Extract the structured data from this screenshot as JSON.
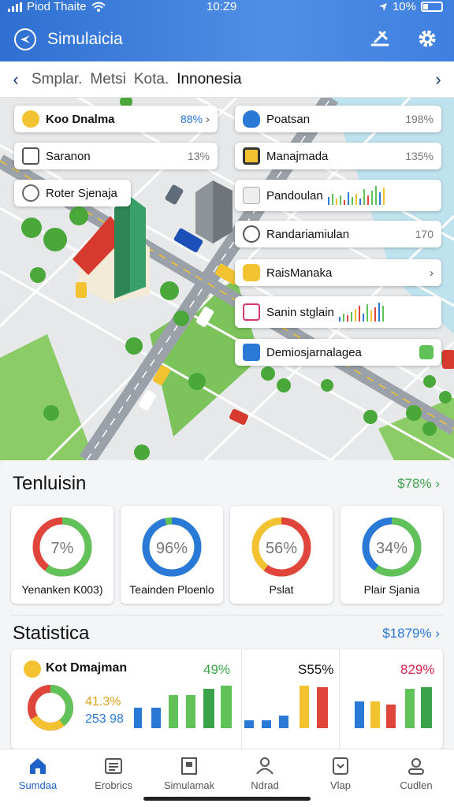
{
  "status": {
    "carrier": "Piod Thaite",
    "time": "10:Z9",
    "battery": "10%"
  },
  "app": {
    "title": "Simulaicia"
  },
  "breadcrumb": {
    "items": [
      "Smplar.",
      "Metsi",
      "Kota.",
      "Innonesia"
    ]
  },
  "map_cards": [
    {
      "label": "Koo Dnalma",
      "value": "88%",
      "chevron": "›"
    },
    {
      "label": "Saranon",
      "value": "13%"
    },
    {
      "label": "Roter Sjenaja"
    },
    {
      "label": "Poatsan",
      "value": "198%"
    },
    {
      "label": "Manajmada",
      "value": "135%"
    },
    {
      "label": "Pandoulan"
    },
    {
      "label": "Randariamiulan",
      "value": "170"
    },
    {
      "label": "RaisManaka",
      "chevron": "›"
    },
    {
      "label": "Sanin stglain"
    },
    {
      "label": "Demiosjarnalagea"
    }
  ],
  "overview": {
    "title": "Tenluisin",
    "link": "$78% ›",
    "gauges": [
      {
        "value": "7%",
        "label": "Yenanken K003)",
        "fill": 0.07,
        "color": "#62c25a",
        "track": "#e0453c"
      },
      {
        "value": "96%",
        "label": "Teainden Ploenlo",
        "fill": 0.96,
        "color": "#2a79d6",
        "track": "#62c25a"
      },
      {
        "value": "56%",
        "label": "Pslat",
        "fill": 0.56,
        "color": "#e0453c",
        "track": "#f2c230"
      },
      {
        "value": "34%",
        "label": "Plair Sjania",
        "fill": 0.34,
        "color": "#62c25a",
        "track": "#2a79d6"
      }
    ]
  },
  "statistics": {
    "title": "Statistica",
    "link": "$1879% ›",
    "name": "Kot Dmajman",
    "pct_a": "49%",
    "pct_b": "41.3%",
    "count": "253 98",
    "pct_c": "S55%",
    "pct_d": "829%"
  },
  "nav": [
    {
      "label": "Sumdaa",
      "icon": "home-icon"
    },
    {
      "label": "Erobrics",
      "icon": "list-icon"
    },
    {
      "label": "Simulamak",
      "icon": "building-icon"
    },
    {
      "label": "Ndrad",
      "icon": "person-icon"
    },
    {
      "label": "Vlap",
      "icon": "map-icon"
    },
    {
      "label": "Cudlen",
      "icon": "profile-icon"
    }
  ],
  "colors": {
    "primary": "#2f6fd1",
    "green": "#62c25a",
    "red": "#e0453c",
    "yellow": "#f2c230",
    "blue": "#2a79d6"
  }
}
